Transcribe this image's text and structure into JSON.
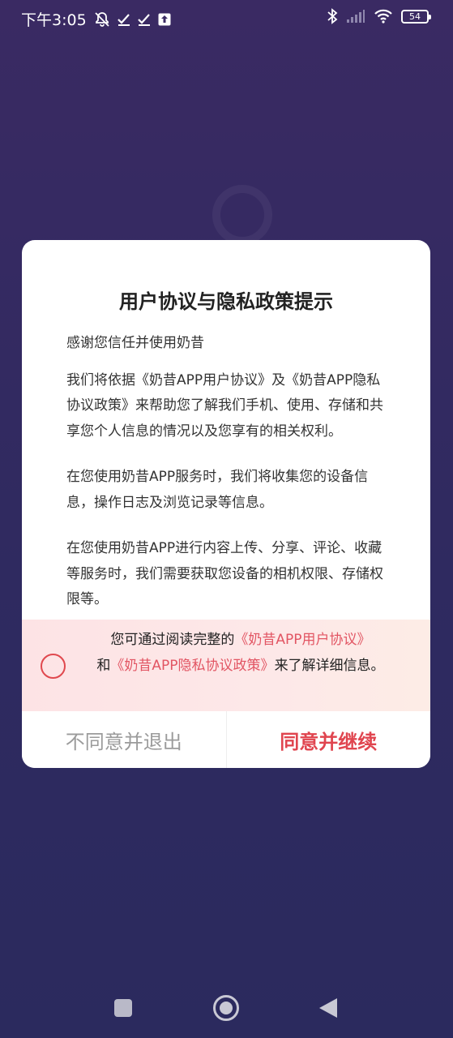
{
  "status_bar": {
    "time": "下午3:05",
    "battery": "54",
    "left_icons": [
      "mute-bell-icon",
      "check-icon",
      "check-icon",
      "upload-icon"
    ],
    "right_icons": [
      "bluetooth-icon",
      "signal-icon",
      "wifi-icon",
      "battery-icon"
    ]
  },
  "dialog": {
    "title": "用户协议与隐私政策提示",
    "paragraphs": [
      "感谢您信任并使用奶昔",
      "我们将依据《奶昔APP用户协议》及《奶昔APP隐私协议政策》来帮助您了解我们手机、使用、存储和共享您个人信息的情况以及您享有的相关权利。",
      "在您使用奶昔APP服务时，我们将收集您的设备信息，操作日志及浏览记录等信息。",
      "在您使用奶昔APP进行内容上传、分享、评论、收藏等服务时，我们需要获取您设备的相机权限、存储权限等。"
    ],
    "consent": {
      "prefix": "您可通过阅读完整的",
      "link_user_agreement": "《奶昔APP用户协议》",
      "and": "和",
      "link_privacy_policy": "《奶昔APP隐私协议政策》",
      "suffix": "来了解详细信息。"
    },
    "buttons": {
      "disagree": "不同意并退出",
      "agree": "同意并继续"
    }
  },
  "colors": {
    "accent": "#e0454f",
    "background": "#2f2a60"
  }
}
